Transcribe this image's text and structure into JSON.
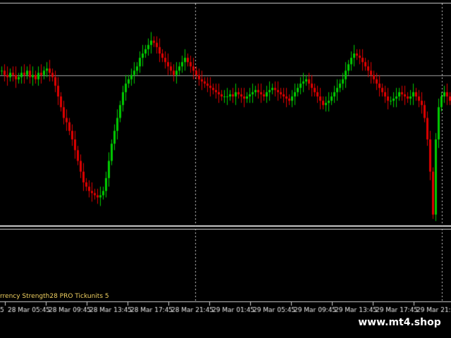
{
  "chart_data": {
    "type": "candlestick",
    "price_range": [
      0,
      100
    ],
    "time_labels": [
      "28 Mar 05:45",
      "28 Mar 09:45",
      "28 Mar 13:45",
      "28 Mar 17:45",
      "28 Mar 21:45",
      "29 Mar 01:45",
      "29 Mar 05:45",
      "29 Mar 09:45",
      "29 Mar 13:45",
      "29 Mar 17:45",
      "29 Mar 21:45"
    ],
    "partial_time_label": "5",
    "indicator_text": "rrency Strength28 PRO  Tickunits 5",
    "horizontal_level": 70,
    "candle_colors": {
      "up": "#00cc00",
      "down": "#e00000"
    },
    "series": [
      {
        "name": "segment-1",
        "close": [
          72,
          70,
          69,
          71,
          70,
          68,
          69,
          71,
          70,
          72,
          69,
          70,
          68,
          71,
          70,
          72,
          73,
          71,
          69,
          65,
          60,
          55,
          50,
          48,
          44,
          40,
          35,
          30,
          25,
          20,
          18,
          16,
          15,
          14,
          13,
          14,
          16,
          22,
          30,
          38,
          44,
          50,
          56,
          62,
          66,
          68,
          70,
          72,
          74,
          78,
          80,
          82,
          84,
          86,
          85,
          83,
          80,
          78,
          76,
          74,
          72,
          70,
          72,
          74,
          76,
          78,
          76,
          74,
          72,
          70,
          68,
          67,
          66,
          65,
          64,
          63,
          62,
          61,
          60,
          60
        ]
      },
      {
        "name": "segment-2",
        "close": [
          60,
          61,
          60,
          62,
          61,
          60,
          59,
          60,
          61,
          62,
          63,
          62,
          61,
          60,
          62,
          63,
          64,
          63,
          62,
          61,
          60,
          59,
          58,
          60,
          62,
          64,
          66,
          67,
          68,
          66,
          64,
          62,
          60,
          58,
          56,
          57,
          58,
          60,
          62,
          64,
          66,
          68,
          72,
          75,
          78,
          80,
          79,
          78,
          76,
          74,
          72,
          70,
          68,
          66,
          64,
          62,
          60,
          58,
          58,
          59,
          60,
          62,
          61,
          60,
          59,
          60,
          62,
          60,
          58,
          56,
          50,
          40,
          25,
          5,
          40,
          55,
          60,
          62,
          60,
          58
        ]
      }
    ]
  }
}
